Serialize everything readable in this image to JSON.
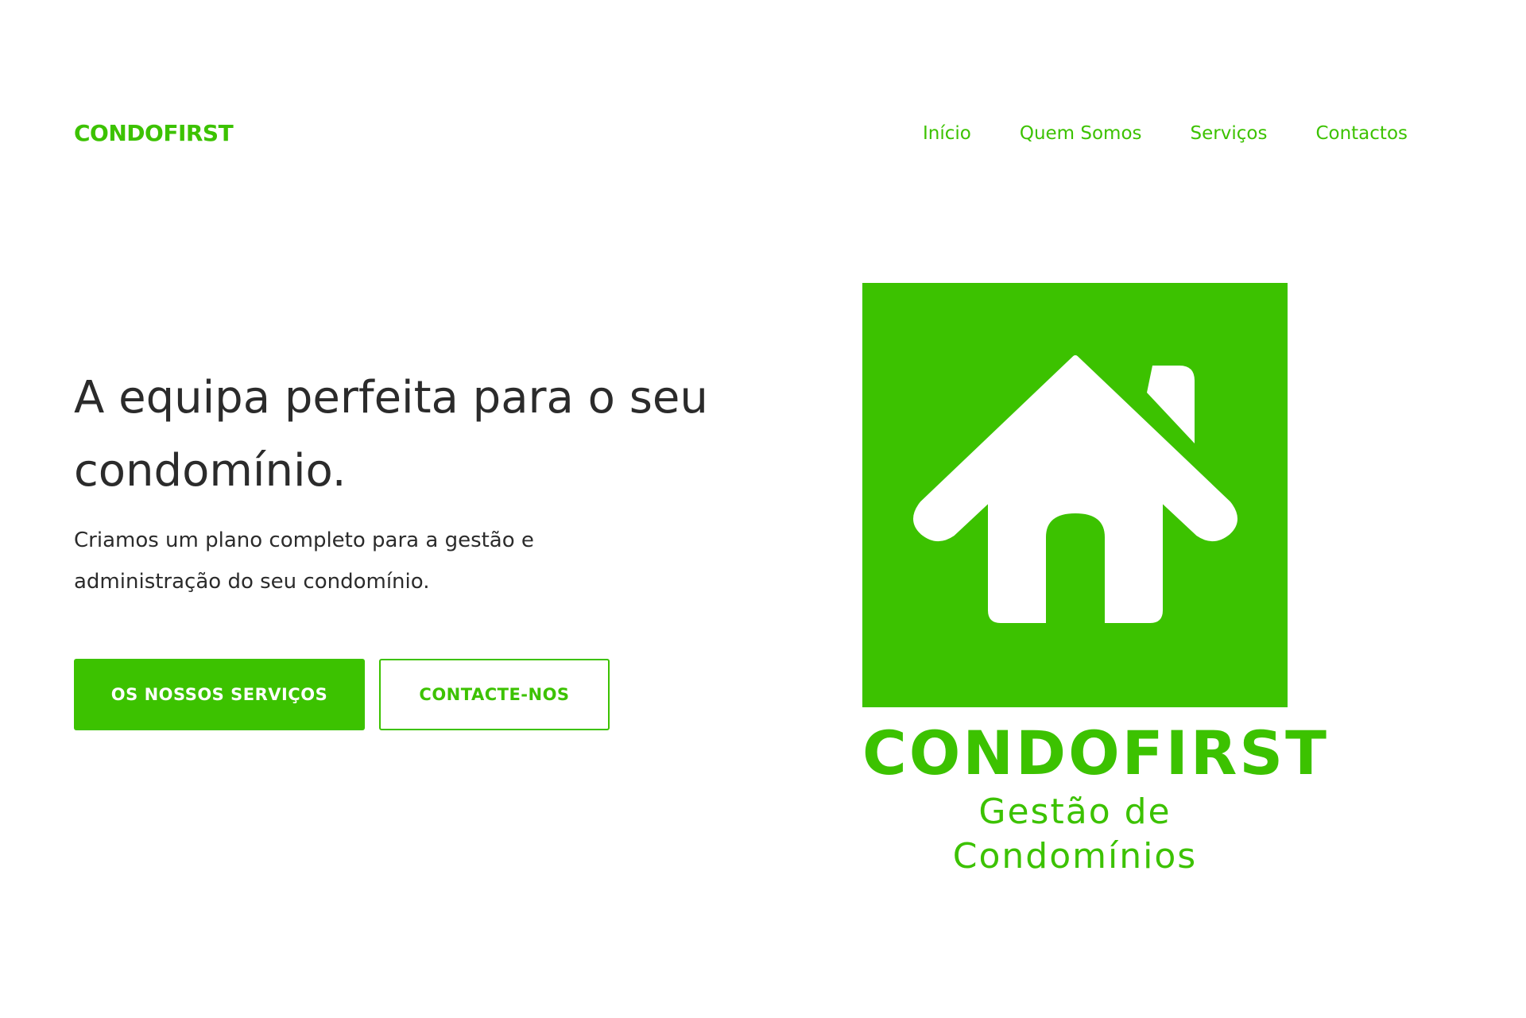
{
  "header": {
    "brand": "CONDOFIRST",
    "nav": [
      {
        "label": "Início"
      },
      {
        "label": "Quem Somos"
      },
      {
        "label": "Serviços"
      },
      {
        "label": "Contactos"
      }
    ]
  },
  "hero": {
    "title": "A equipa perfeita para o seu condomínio.",
    "subtitle": "Criamos um plano completo para a gestão e administração do seu condomínio.",
    "primary_button": "OS NOSSOS SERVIÇOS",
    "secondary_button": "CONTACTE-NOS"
  },
  "logo": {
    "icon": "house-icon",
    "name": "CONDOFIRST",
    "tagline": "Gestão de Condomínios"
  },
  "colors": {
    "brand_green": "#3cc200",
    "text_dark": "#2b2b2b",
    "background": "#ffffff"
  }
}
